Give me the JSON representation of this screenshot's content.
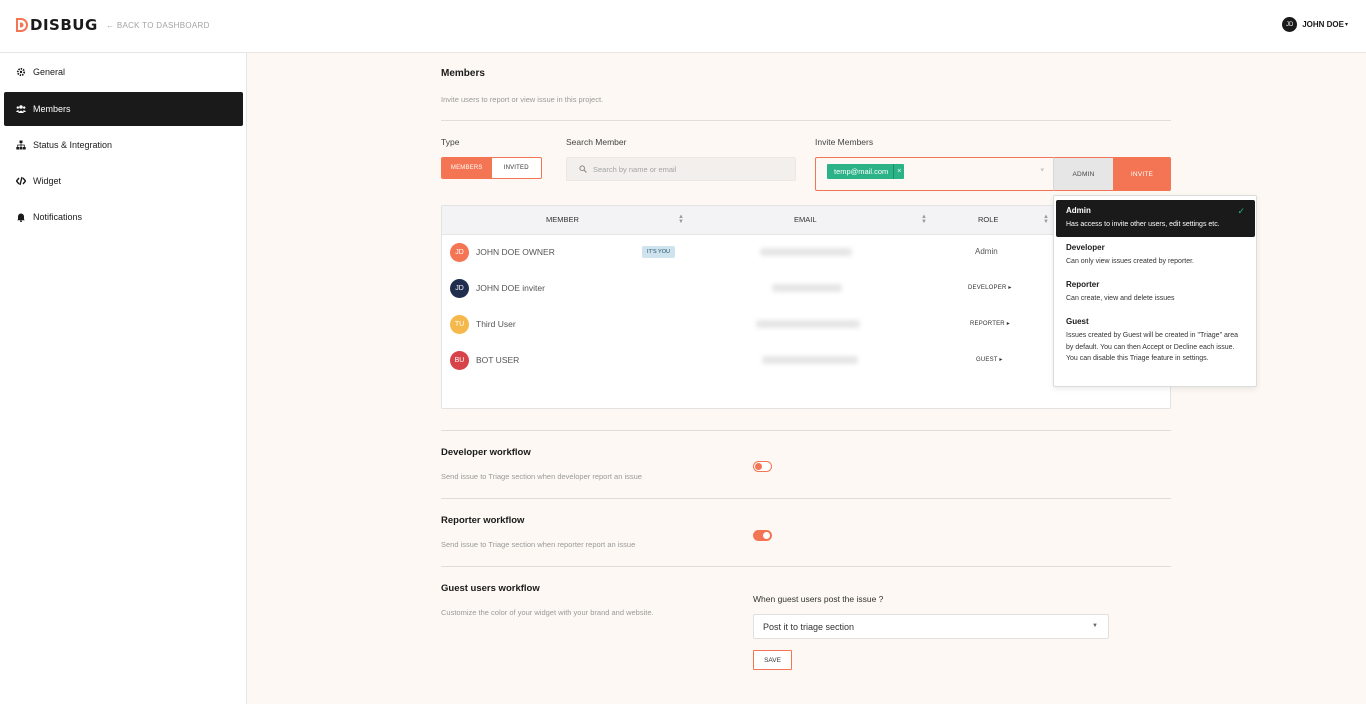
{
  "header": {
    "logo": "DISBUG",
    "back_link": "← BACK TO DASHBOARD",
    "user_initials": "JD",
    "user_name": "JOHN DOE"
  },
  "sidebar": {
    "items": [
      {
        "label": "General",
        "icon": "gear-icon"
      },
      {
        "label": "Members",
        "icon": "users-icon",
        "active": true
      },
      {
        "label": "Status & Integration",
        "icon": "sitemap-icon"
      },
      {
        "label": "Widget",
        "icon": "code-icon"
      },
      {
        "label": "Notifications",
        "icon": "bell-icon"
      }
    ]
  },
  "members": {
    "title": "Members",
    "description": "Invite users to report or view issue in this project.",
    "type_label": "Type",
    "type_members": "MEMBERS",
    "type_invited": "INVITED",
    "search_label": "Search Member",
    "search_placeholder": "Search by name or email",
    "invite_label": "Invite Members",
    "invite_tag": "temp@mail.com",
    "invite_tag_remove": "×",
    "admin_button": "ADMIN",
    "invite_button": "INVITE"
  },
  "table": {
    "headers": {
      "member": "MEMBER",
      "email": "EMAIL",
      "role": "ROLE"
    },
    "rows": [
      {
        "initials": "JD",
        "name": "JOHN DOE OWNER",
        "badge": "IT'S YOU",
        "role": "Admin",
        "avatar_color": "#f47553"
      },
      {
        "initials": "JD",
        "name": "JOHN DOE inviter",
        "role": "DEVELOPER",
        "avatar_color": "#1f2d4f"
      },
      {
        "initials": "TU",
        "name": "Third User",
        "role": "REPORTER",
        "avatar_color": "#f5b84a"
      },
      {
        "initials": "BU",
        "name": "BOT USER",
        "role": "GUEST",
        "avatar_color": "#d8434a"
      }
    ]
  },
  "role_dropdown": {
    "options": [
      {
        "name": "Admin",
        "desc": "Has access to invite other users, edit settings etc.",
        "selected": true
      },
      {
        "name": "Developer",
        "desc": "Can only view issues created by reporter."
      },
      {
        "name": "Reporter",
        "desc": "Can create, view and delete issues"
      },
      {
        "name": "Guest",
        "desc": "Issues created by Guest will be created in \"Triage\" area by default. You can then Accept or Decline each issue. You can disable this Triage feature in settings."
      }
    ]
  },
  "workflows": {
    "developer": {
      "title": "Developer workflow",
      "desc": "Send issue to Triage section when developer report an issue",
      "enabled": false
    },
    "reporter": {
      "title": "Reporter workflow",
      "desc": "Send issue to Triage section when reporter report an issue",
      "enabled": true
    },
    "guest": {
      "title": "Guest users workflow",
      "desc": "Customize the color of your widget with your brand and website.",
      "question": "When guest users post the issue ?",
      "selected": "Post it to triage section",
      "save": "SAVE"
    }
  },
  "colors": {
    "accent": "#f47553",
    "dark": "#1a1a1a",
    "tag": "#2bb286",
    "background": "#fdf8f3"
  }
}
